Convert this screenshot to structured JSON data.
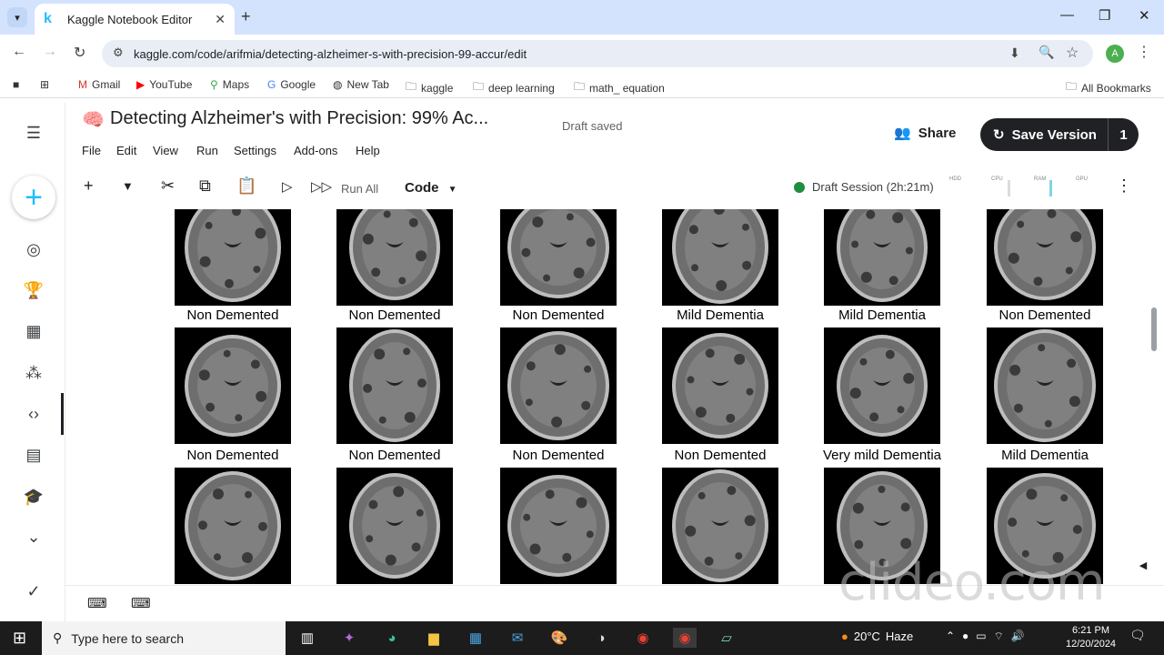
{
  "browser": {
    "tab_title": "Kaggle Notebook Editor",
    "tab_favicon": "k",
    "url": "kaggle.com/code/arifmia/detecting-alzheimer-s-with-precision-99-accur/edit",
    "avatar_letter": "A",
    "bookmarks": [
      "Gmail",
      "YouTube",
      "Maps",
      "Google",
      "New Tab",
      "kaggle",
      "deep learning",
      "math_ equation"
    ],
    "all_bookmarks": "All Bookmarks"
  },
  "notebook": {
    "title": "Detecting Alzheimer's with Precision: 99% Ac...",
    "status": "Draft saved",
    "menu": [
      "File",
      "Edit",
      "View",
      "Run",
      "Settings",
      "Add-ons",
      "Help"
    ],
    "share_label": "Share",
    "save_label": "Save Version",
    "save_count": "1"
  },
  "toolbar": {
    "run_all": "Run All",
    "cell_type": "Code",
    "session": "Draft Session (2h:21m)",
    "meters": [
      "HDD",
      "CPU",
      "RAM",
      "GPU"
    ]
  },
  "grid": {
    "captions": [
      [
        "Non Demented",
        "Non Demented",
        "Non Demented",
        "Mild Dementia",
        "Mild Dementia",
        "Non Demented"
      ],
      [
        "Non Demented",
        "Non Demented",
        "Non Demented",
        "Non Demented",
        "Very mild Dementia",
        "Mild Dementia"
      ]
    ]
  },
  "taskbar": {
    "search_placeholder": "Type here to search",
    "temperature": "20°C",
    "weather": "Haze",
    "time": "6:21 PM",
    "date": "12/20/2024"
  },
  "watermark": "clideo.com",
  "colors": {
    "kaggle_blue": "#20beff",
    "session_green": "#1e8e3e",
    "save_button": "#202124"
  }
}
